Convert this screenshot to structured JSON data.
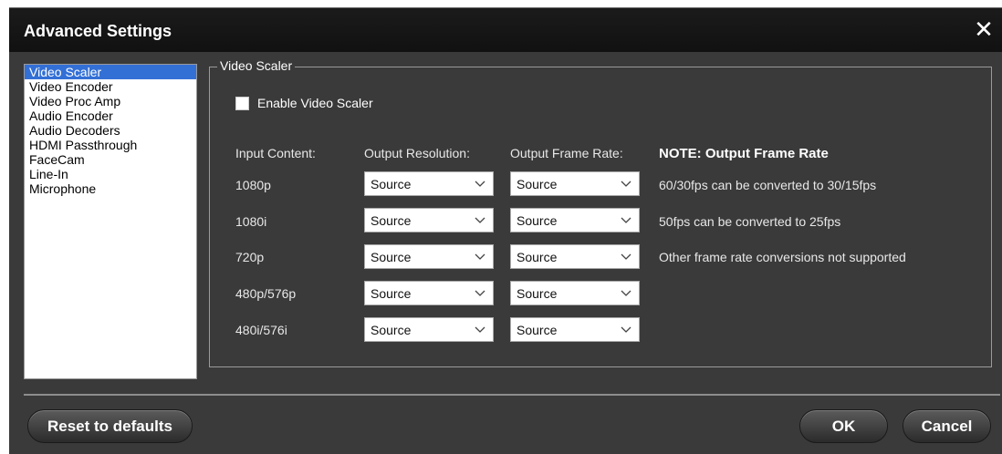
{
  "window": {
    "title": "Advanced Settings"
  },
  "categories": [
    "Video Scaler",
    "Video Encoder",
    "Video Proc Amp",
    "Audio Encoder",
    "Audio Decoders",
    "HDMI Passthrough",
    "FaceCam",
    "Line-In",
    "Microphone"
  ],
  "selected_category": "Video Scaler",
  "panel": {
    "legend": "Video Scaler",
    "enable_label": "Enable Video Scaler",
    "enable_checked": false,
    "headers": {
      "input": "Input Content:",
      "resolution": "Output Resolution:",
      "frame_rate": "Output Frame Rate:"
    },
    "rows": [
      {
        "label": "1080p",
        "resolution": "Source",
        "frame_rate": "Source"
      },
      {
        "label": "1080i",
        "resolution": "Source",
        "frame_rate": "Source"
      },
      {
        "label": "720p",
        "resolution": "Source",
        "frame_rate": "Source"
      },
      {
        "label": "480p/576p",
        "resolution": "Source",
        "frame_rate": "Source"
      },
      {
        "label": "480i/576i",
        "resolution": "Source",
        "frame_rate": "Source"
      }
    ],
    "note_title": "NOTE: Output Frame Rate",
    "notes": [
      "60/30fps can be converted to 30/15fps",
      "50fps can be converted to 25fps",
      "Other frame rate conversions not supported"
    ]
  },
  "buttons": {
    "reset": "Reset to defaults",
    "ok": "OK",
    "cancel": "Cancel"
  },
  "icons": {
    "close": "close-icon",
    "dropdown": "chevron-down-icon"
  },
  "colors": {
    "selection": "#3370d6",
    "background": "#3a3a3a",
    "titlebar": "#151515"
  }
}
